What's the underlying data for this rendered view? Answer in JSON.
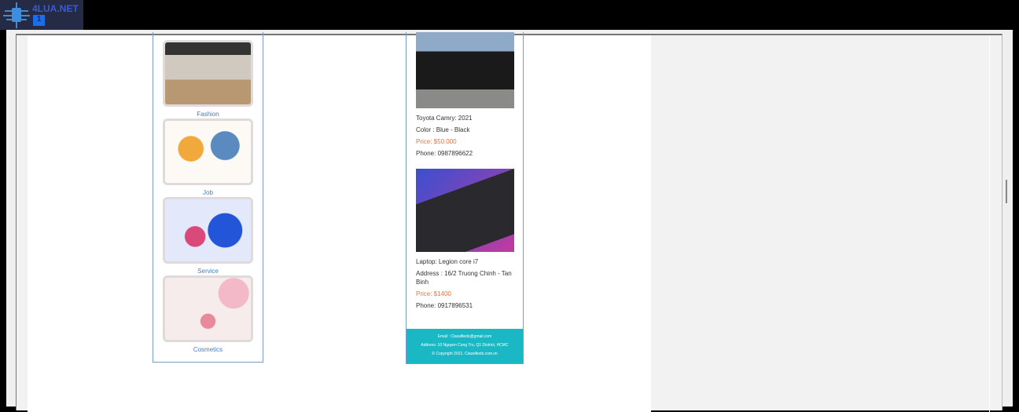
{
  "watermark": {
    "text": "4LUA.NET",
    "badge": "1"
  },
  "categories": [
    {
      "label": "Fashion"
    },
    {
      "label": "Job"
    },
    {
      "label": "Service"
    },
    {
      "label": "Cosmetics"
    }
  ],
  "ads": [
    {
      "title": "Toyota Camry: 2021",
      "detail": "Color : Blue - Black",
      "price": "Price: $50.000",
      "phone": "Phone: 0987896622"
    },
    {
      "title": "Laptop: Legion core i7",
      "detail": "Address : 16/2 Truong Chinh - Tan Binh",
      "price": "Price: $1400",
      "phone": "Phone: 0917896531"
    }
  ],
  "footer": {
    "email": "Email : Classifieds@gmail.com",
    "address": "Address: 10 Nguyen Cong Tru, Q1 District, HCMC",
    "copyright": "© Copyright 2021. Classifieds.com.vn"
  }
}
